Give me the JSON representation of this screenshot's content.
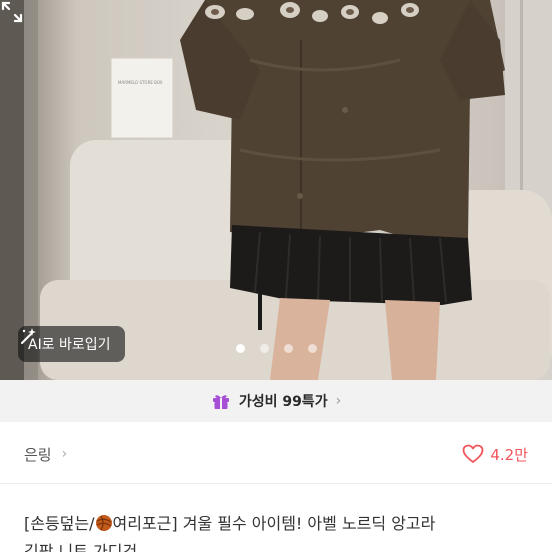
{
  "gallery": {
    "ai_button_label": "AI로 바로입기",
    "page_count": 4,
    "active_page": 1,
    "ai_icon": "magic-wand-icon",
    "expand_icon": "expand-icon",
    "box_text": "MARMELO STORE BOX"
  },
  "promo": {
    "label": "가성비 99특가",
    "icon": "gift-icon",
    "chevron": "›",
    "icon_color": "#a64fd6"
  },
  "shop": {
    "name": "은링",
    "chevron": "›",
    "like_count": "4.2만",
    "like_icon": "heart-outline-icon",
    "like_color": "#f0565d"
  },
  "product": {
    "title_part1": "[손등덮는/",
    "title_part2": "여리포근] 겨울 필수 아이템! 아벨 노르딕 앙고라",
    "title_line2": "김팡 니트 가디건",
    "emoji_icon": "yarn-ball-icon"
  }
}
